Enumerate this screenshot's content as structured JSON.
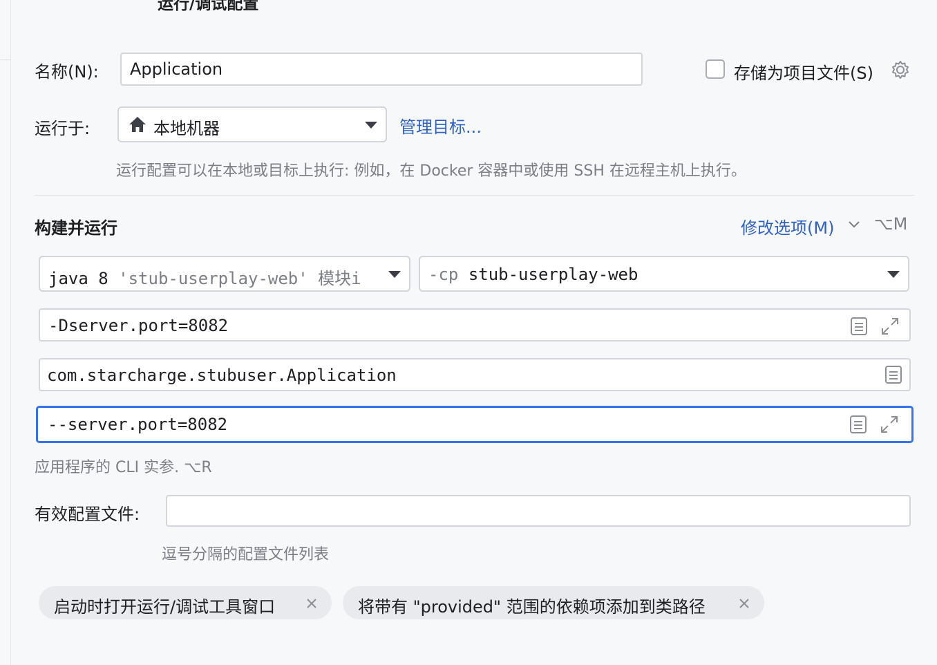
{
  "dialog": {
    "title": "运行/调试配置"
  },
  "name_row": {
    "label": "名称(N):",
    "value": "Application",
    "store_checkbox_label": "存储为项目文件(S)",
    "store_checked": false
  },
  "run_on_row": {
    "label": "运行于:",
    "target": "本地机器",
    "manage_link": "管理目标...",
    "hint": "运行配置可以在本地或目标上执行: 例如，在 Docker 容器中或使用 SSH 在远程主机上执行。"
  },
  "build_run": {
    "section_title": "构建并运行",
    "modify_options": "修改选项(M)",
    "modify_shortcut": "⌥M",
    "jdk": {
      "prefix": "java 8",
      "module": "'stub-userplay-web'",
      "suffix": "模块i"
    },
    "classpath": {
      "prefix": "-cp",
      "value": "stub-userplay-web"
    },
    "vm_options": "-Dserver.port=8082",
    "main_class": "com.starcharge.stubuser.Application",
    "program_args": "--server.port=8082",
    "program_args_hint": "应用程序的 CLI 实参. ⌥R"
  },
  "profiles": {
    "label": "有效配置文件:",
    "value": "",
    "hint": "逗号分隔的配置文件列表"
  },
  "chips": [
    {
      "label": "启动时打开运行/调试工具窗口"
    },
    {
      "label": "将带有 \"provided\" 范围的依赖项添加到类路径"
    }
  ],
  "icons": {
    "gear": "gear-icon",
    "home": "home-icon",
    "chevron": "chevron-down-icon",
    "list": "list-icon",
    "expand": "expand-icon",
    "close": "close-icon"
  },
  "colors": {
    "accent": "#3574f0",
    "link": "#2f62c4",
    "hint": "#7b7e85",
    "background": "#f7f8fa"
  }
}
